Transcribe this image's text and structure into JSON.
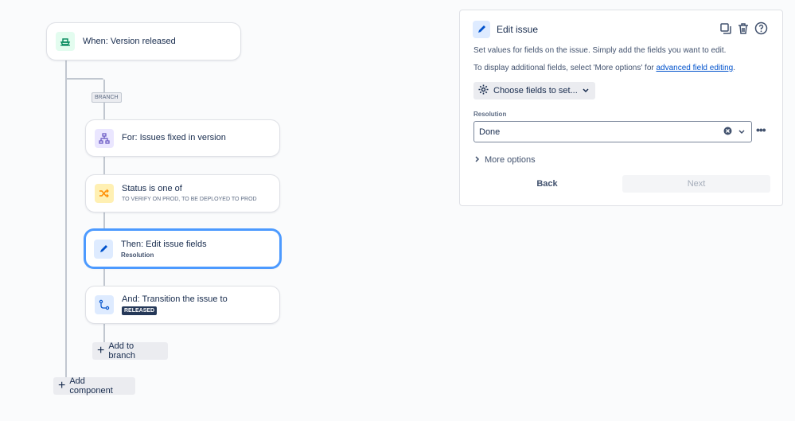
{
  "flow": {
    "trigger": {
      "title": "When: Version released",
      "icon": "ship-icon"
    },
    "branch_badge": "BRANCH",
    "branch_card": {
      "title": "For: Issues fixed in version",
      "icon": "hierarchy-icon"
    },
    "condition_card": {
      "title": "Status is one of",
      "subtitle": "TO VERIFY ON PROD, TO BE DEPLOYED TO PROD",
      "icon": "shuffle-icon"
    },
    "action_card": {
      "title": "Then: Edit issue fields",
      "subtitle": "Resolution",
      "icon": "pencil-icon"
    },
    "transition_card": {
      "title": "And: Transition the issue to",
      "status": "RELEASED",
      "icon": "transition-icon"
    },
    "add_to_branch": "Add to branch",
    "add_component": "Add component"
  },
  "panel": {
    "title": "Edit issue",
    "desc1": "Set values for fields on the issue. Simply add the fields you want to edit.",
    "desc2_prefix": "To display additional fields, select 'More options' for ",
    "desc2_link": "advanced field editing",
    "desc2_suffix": ".",
    "choose_fields": "Choose fields to set...",
    "resolution_label": "Resolution",
    "resolution_value": "Done",
    "more_options": "More options",
    "back": "Back",
    "next": "Next"
  },
  "colors": {
    "accent": "#0052cc",
    "selected_border": "#4c9aff"
  }
}
